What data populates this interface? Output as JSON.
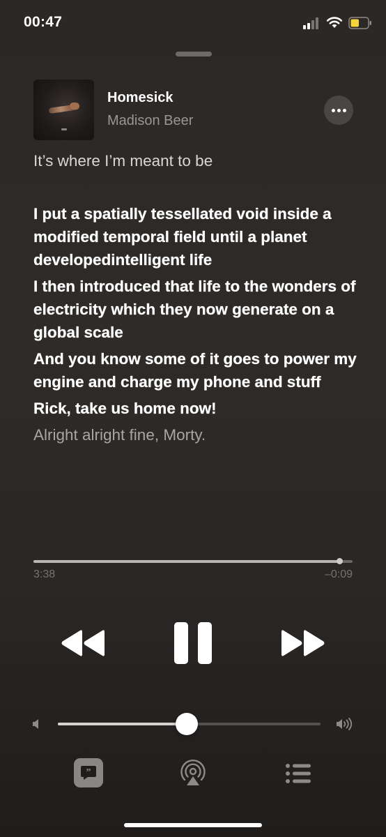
{
  "status_bar": {
    "time": "00:47",
    "signal_icon": "signal-icon",
    "wifi_icon": "wifi-icon",
    "battery_icon": "battery-icon",
    "battery_color": "#f5d53c",
    "battery_level": 0.5
  },
  "now_playing": {
    "title": "Homesick",
    "artist": "Madison Beer",
    "more_icon": "more-icon"
  },
  "lyrics": {
    "previous": [
      "It’s where I’m meant to be",
      ""
    ],
    "current": [
      "I put a spatially tessellated void inside a modified temporal field until a planet developedintelligent life",
      "I then introduced that life to the wonders of electricity which they now generate on a global scale",
      "And you know some of it goes to power my engine and charge my phone and stuff",
      "Rick, take us home now!"
    ],
    "next": [
      "Alright alright fine, Morty."
    ]
  },
  "playback": {
    "elapsed": "3:38",
    "remaining": "–0:09",
    "progress": 0.96
  },
  "controls": {
    "rewind_icon": "rewind-icon",
    "pause_icon": "pause-icon",
    "fast_forward_icon": "fast-forward-icon"
  },
  "volume": {
    "level": 0.49,
    "low_icon": "volume-low-icon",
    "high_icon": "volume-high-icon"
  },
  "bottom_bar": {
    "lyrics_icon": "lyrics-icon",
    "airplay_icon": "airplay-icon",
    "queue_icon": "queue-icon"
  },
  "colors": {
    "accent_track": "#b9b5b2",
    "dim_text": "#77726f",
    "button_bg": "#4a4644"
  }
}
